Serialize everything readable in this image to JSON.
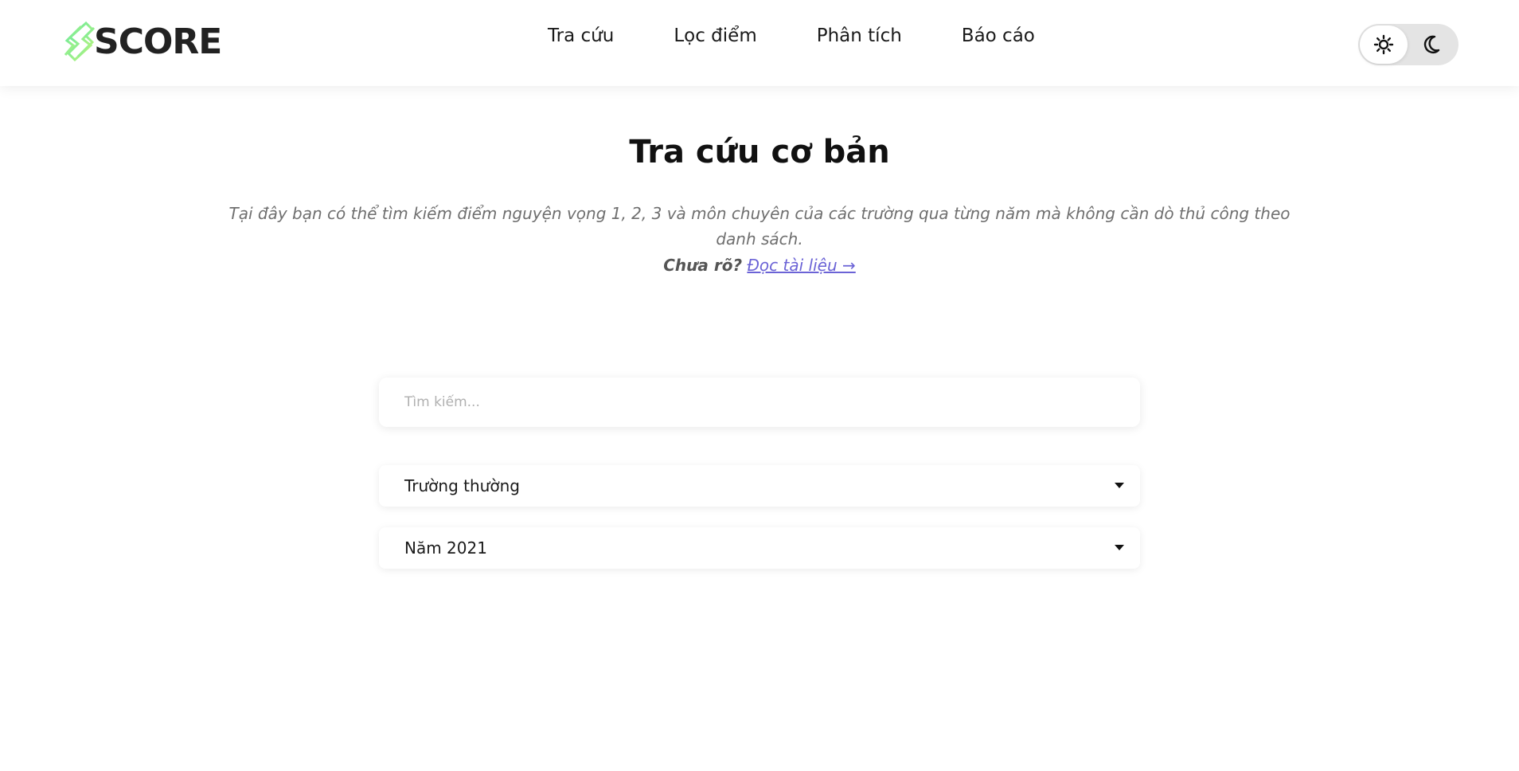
{
  "header": {
    "logo_text": "SCORE",
    "nav": [
      {
        "label": "Tra cứu"
      },
      {
        "label": "Lọc điểm"
      },
      {
        "label": "Phân tích"
      },
      {
        "label": "Báo cáo"
      }
    ],
    "theme_toggle": {
      "active": "light",
      "light_icon": "sun-icon",
      "dark_icon": "moon-icon"
    }
  },
  "main": {
    "title": "Tra cứu cơ bản",
    "description": "Tại đây bạn có thể tìm kiếm điểm nguyện vọng 1, 2, 3 và môn chuyên của các trường qua từng năm mà không cần dò thủ công theo danh sách.",
    "help_question": "Chưa rõ?",
    "help_link": "Đọc tài liệu →",
    "search": {
      "placeholder": "Tìm kiếm...",
      "value": ""
    },
    "school_type_select": {
      "value": "Trường thường"
    },
    "year_select": {
      "value": "Năm 2021"
    }
  },
  "colors": {
    "logo_gradient_start": "#5ee8a0",
    "logo_gradient_end": "#c8f57a",
    "link": "#6b63d6",
    "toggle_track": "#e4e4e4"
  }
}
